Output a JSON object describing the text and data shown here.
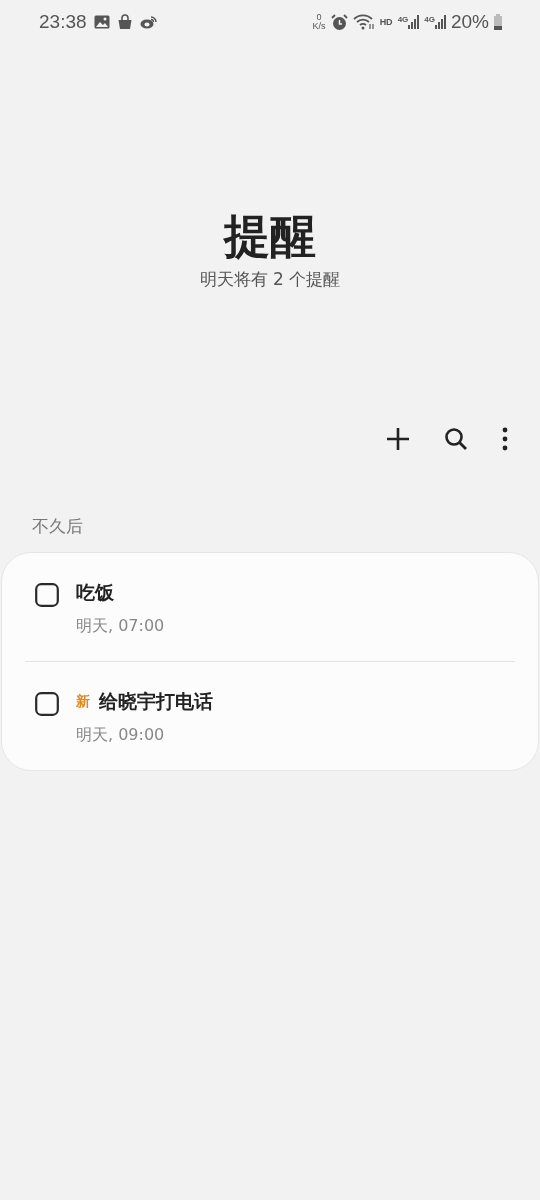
{
  "status_bar": {
    "time": "23:38",
    "net_speed_value": "0",
    "net_speed_unit": "K/s",
    "hd": "HD",
    "sim_1": "4G",
    "sim_2": "4G",
    "battery": "20%"
  },
  "header": {
    "title": "提醒",
    "subtitle": "明天将有 2 个提醒"
  },
  "section": {
    "label": "不久后"
  },
  "reminders": [
    {
      "title": "吃饭",
      "time": "明天, 07:00",
      "checked": false
    },
    {
      "badge": "新",
      "title": "给晓宇打电话",
      "time": "明天, 09:00",
      "checked": false
    }
  ]
}
